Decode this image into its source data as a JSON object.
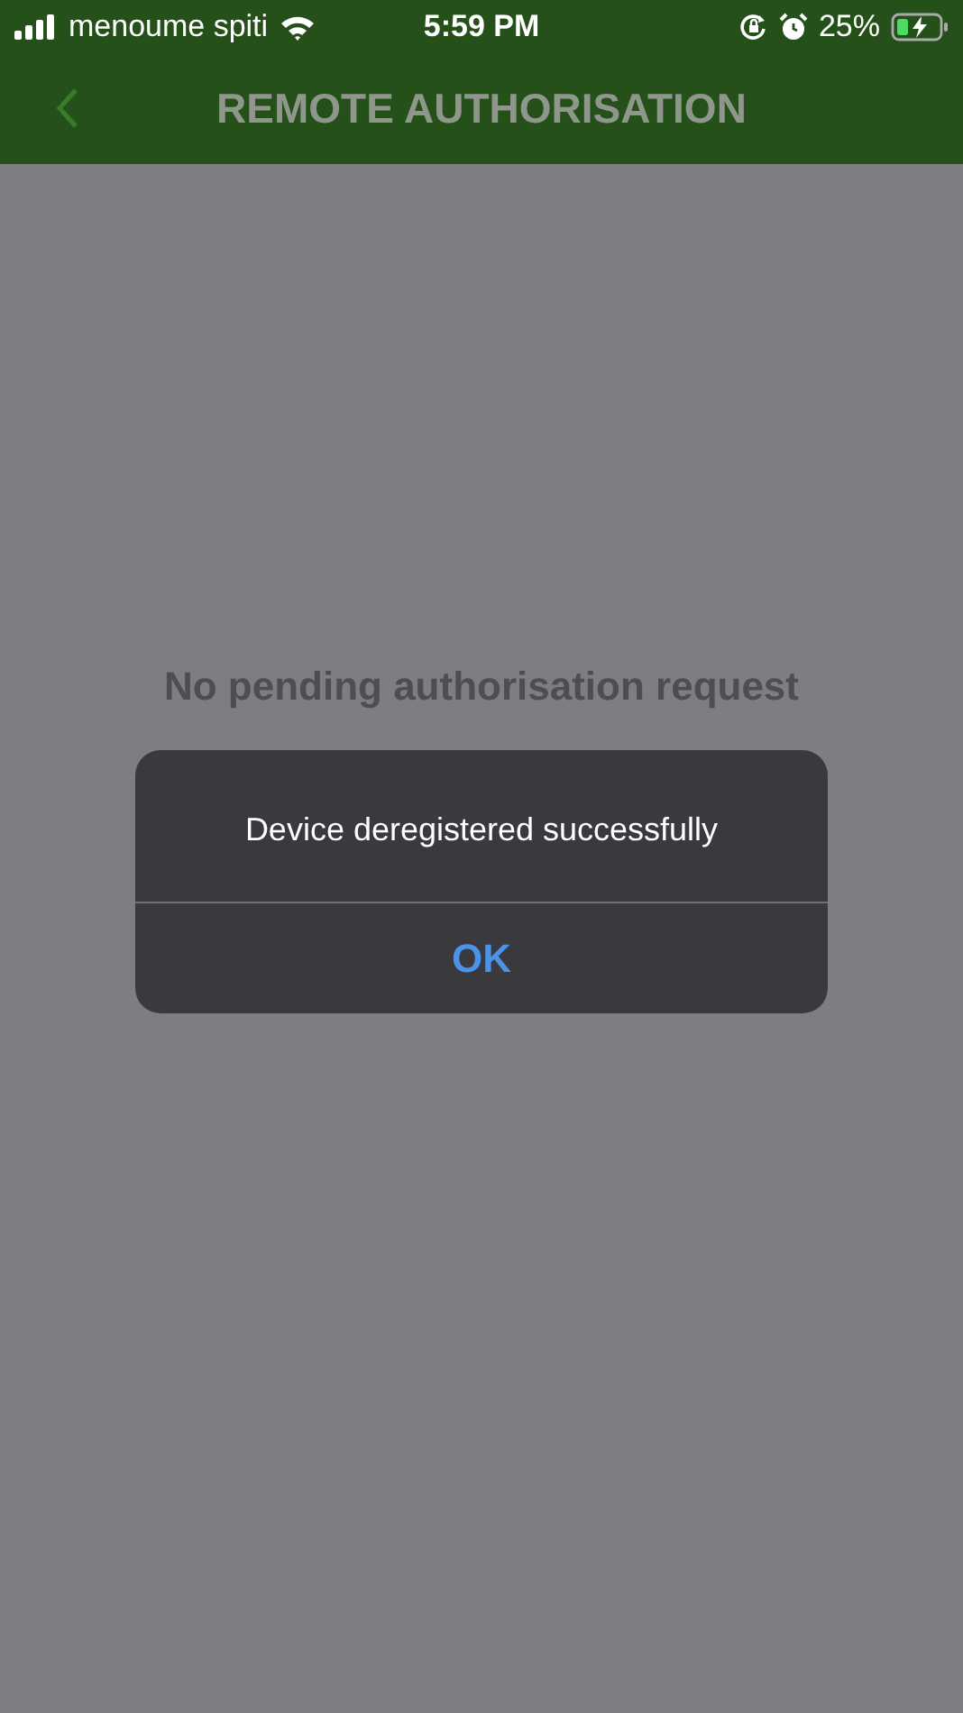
{
  "status_bar": {
    "carrier": "menoume spiti",
    "time": "5:59 PM",
    "battery": "25%"
  },
  "nav_bar": {
    "title": "REMOTE AUTHORISATION"
  },
  "empty_message": "No pending authorisation request",
  "alert": {
    "message": "Device deregistered successfully",
    "buttons": [
      "OK"
    ]
  }
}
